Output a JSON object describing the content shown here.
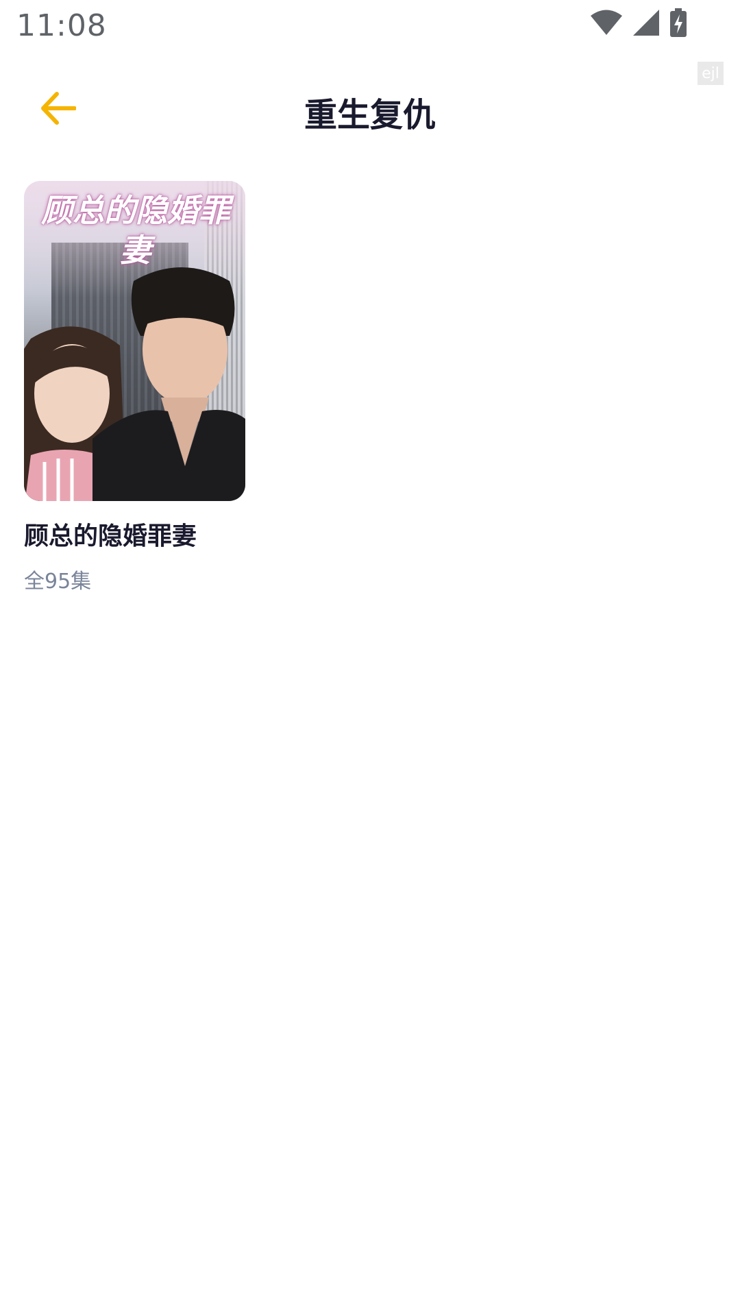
{
  "status_bar": {
    "time": "11:08",
    "icons": [
      "wifi-icon",
      "signal-icon",
      "battery-charging-icon"
    ]
  },
  "watermark": "ejl",
  "header": {
    "title": "重生复仇",
    "back_icon": "arrow-left-icon",
    "accent_color": "#F5B400"
  },
  "items": [
    {
      "cover_title": "顾总的隐婚罪妻",
      "title": "顾总的隐婚罪妻",
      "episodes": "全95集"
    }
  ]
}
